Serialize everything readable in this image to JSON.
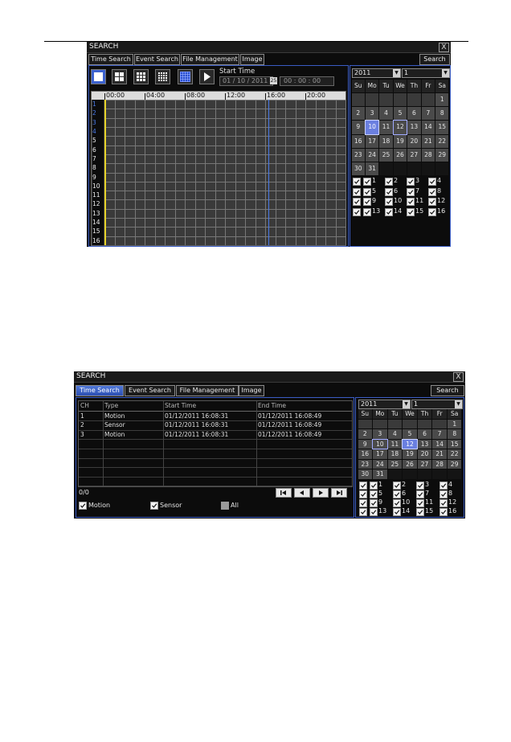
{
  "time_search": {
    "title": "SEARCH",
    "close": "X",
    "tabs": [
      "Time Search",
      "Event Search",
      "File Management",
      "Image"
    ],
    "active_tab": 0,
    "search_button": "Search",
    "start_time_label": "Start Time",
    "date_value": "01 / 10 / 2011",
    "time_value": "00 : 00 : 00",
    "calendar_button": "25",
    "view_buttons": [
      "1-split-icon",
      "4-split-icon",
      "9-split-icon",
      "16-split-icon",
      "full-grid-icon",
      "play-icon"
    ],
    "timeline_hours": [
      "00:00",
      "04:00",
      "08:00",
      "12:00",
      "16:00",
      "20:00"
    ],
    "channels": [
      "1",
      "2",
      "3",
      "4",
      "5",
      "6",
      "7",
      "8",
      "9",
      "10",
      "11",
      "12",
      "13",
      "14",
      "15",
      "16"
    ],
    "highlight_channels": [
      1,
      2,
      3,
      4
    ],
    "calendar": {
      "year": "2011",
      "month": "1",
      "weekdays": [
        "Su",
        "Mo",
        "Tu",
        "We",
        "Th",
        "Fr",
        "Sa"
      ],
      "days": [
        "",
        "",
        "",
        "",
        "",
        "",
        "1",
        "2",
        "3",
        "4",
        "5",
        "6",
        "7",
        "8",
        "9",
        "10",
        "11",
        "12",
        "13",
        "14",
        "15",
        "16",
        "17",
        "18",
        "19",
        "20",
        "21",
        "22",
        "23",
        "24",
        "25",
        "26",
        "27",
        "28",
        "29",
        "30",
        "31"
      ],
      "selected": "10",
      "marked": [
        "12"
      ]
    },
    "channel_checks": [
      "",
      "1",
      "2",
      "3",
      "4",
      "",
      "5",
      "6",
      "7",
      "8",
      "",
      "9",
      "10",
      "11",
      "12",
      "",
      "13",
      "14",
      "15",
      "16"
    ]
  },
  "event_search": {
    "title": "SEARCH",
    "close": "X",
    "tabs": [
      "Time Search",
      "Event Search",
      "File Management",
      "Image"
    ],
    "active_tab": 1,
    "search_button": "Search",
    "columns": [
      "CH",
      "Type",
      "Start Time",
      "End Time"
    ],
    "rows": [
      [
        "1",
        "Motion",
        "01/12/2011 16:08:31",
        "01/12/2011 16:08:49"
      ],
      [
        "2",
        "Sensor",
        "01/12/2011 16:08:31",
        "01/12/2011 16:08:49"
      ],
      [
        "3",
        "Motion",
        "01/12/2011 16:08:31",
        "01/12/2011 16:08:49"
      ]
    ],
    "empty_rows": 5,
    "page_count": "0/0",
    "filters": [
      {
        "label": "Motion",
        "checked": true
      },
      {
        "label": "Sensor",
        "checked": true
      },
      {
        "label": "All",
        "checked": false
      }
    ],
    "calendar": {
      "year": "2011",
      "month": "1",
      "weekdays": [
        "Su",
        "Mo",
        "Tu",
        "We",
        "Th",
        "Fr",
        "Sa"
      ],
      "days": [
        "",
        "",
        "",
        "",
        "",
        "",
        "1",
        "2",
        "3",
        "4",
        "5",
        "6",
        "7",
        "8",
        "9",
        "10",
        "11",
        "12",
        "13",
        "14",
        "15",
        "16",
        "17",
        "18",
        "19",
        "20",
        "21",
        "22",
        "23",
        "24",
        "25",
        "26",
        "27",
        "28",
        "29",
        "30",
        "31"
      ],
      "selected": "12",
      "marked": [
        "10"
      ]
    },
    "channel_checks": [
      "",
      "1",
      "2",
      "3",
      "4",
      "",
      "5",
      "6",
      "7",
      "8",
      "",
      "9",
      "10",
      "11",
      "12",
      "",
      "13",
      "14",
      "15",
      "16"
    ]
  },
  "colors": {
    "accent_blue": "#2c4fb3",
    "timeline_cursor_yellow": "#e6d22a",
    "timeline_marker_blue": "#4a7ae8"
  }
}
